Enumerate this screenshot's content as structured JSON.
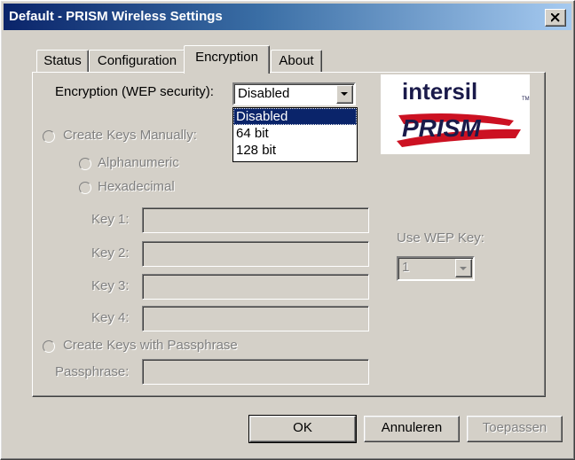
{
  "window": {
    "title": "Default - PRISM Wireless Settings",
    "close_glyph": "✕"
  },
  "tabs": [
    "Status",
    "Configuration",
    "Encryption",
    "About"
  ],
  "active_tab": "Encryption",
  "encryption": {
    "label": "Encryption (WEP security):",
    "selected": "Disabled",
    "options": [
      "Disabled",
      "64 bit",
      "128 bit"
    ]
  },
  "manual": {
    "label": "Create Keys Manually:",
    "alphanumeric": "Alphanumeric",
    "hexadecimal": "Hexadecimal"
  },
  "keys": [
    "Key 1:",
    "Key 2:",
    "Key 3:",
    "Key 4:"
  ],
  "use_wep_key": {
    "label": "Use WEP Key:",
    "value": "1"
  },
  "passphrase": {
    "radio_label": "Create Keys with Passphrase",
    "field_label": "Passphrase:"
  },
  "logo": {
    "brand_top": "intersil",
    "brand_bottom": "PRISM"
  },
  "buttons": {
    "ok": "OK",
    "cancel": "Annuleren",
    "apply": "Toepassen"
  },
  "colors": {
    "title_start": "#0a246a",
    "face": "#d4d0c8",
    "logo_red": "#cc1122",
    "logo_navy": "#1a1a4a"
  }
}
